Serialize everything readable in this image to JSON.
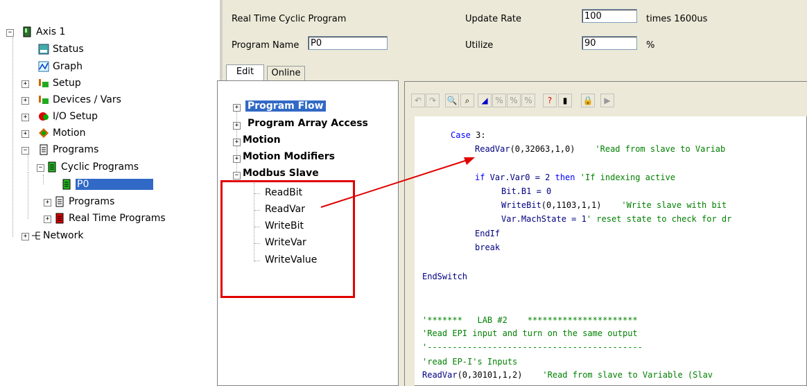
{
  "left_tree": {
    "root": "Axis 1",
    "status": "Status",
    "graph": "Graph",
    "setup": "Setup",
    "devices": "Devices / Vars",
    "io_setup": "I/O Setup",
    "motion": "Motion",
    "programs": "Programs",
    "cyclic_programs": "Cyclic Programs",
    "p0": "P0",
    "sub_programs": "Programs",
    "real_time_programs": "Real Time Programs",
    "network": "Network"
  },
  "header": {
    "title": "Real Time Cyclic Program",
    "update_rate_label": "Update Rate",
    "update_rate_value": "100",
    "update_rate_unit": "times  1600us",
    "program_name_label": "Program Name",
    "program_name_value": "P0",
    "utilize_label": "Utilize",
    "utilize_value": "90",
    "utilize_unit": "%"
  },
  "tabs": [
    "Edit",
    "Online"
  ],
  "func_tree": {
    "program_flow": "Program Flow",
    "program_array_access": "Program Array Access",
    "motion": "Motion",
    "motion_modifiers": "Motion Modifiers",
    "modbus_slave": "Modbus Slave",
    "modbus_items": [
      "ReadBit",
      "ReadVar",
      "WriteBit",
      "WriteVar",
      "WriteValue"
    ]
  },
  "code": {
    "l1_kw": "Case",
    "l1_rest": " 3:",
    "l2_fn": "ReadVar",
    "l2_args": "(0,32063,1,0)",
    "l2_cm": "    'Read from slave to Variab",
    "l3_if": "if",
    "l3_var": " Var.Var0 = 2 ",
    "l3_then": "then",
    "l3_cm": " 'If indexing active",
    "l4": "Bit.B1 = 0",
    "l5_fn": "WriteBit",
    "l5_args": "(0,1103,1,1)",
    "l5_cm": "    'Write slave with bit",
    "l6_var": "Var.MachState = 1",
    "l6_cm": "' reset state to check for dr",
    "l7": "EndIf",
    "l8": "break",
    "l9": "EndSwitch",
    "l10": "'*******   LAB #2    **********************",
    "l11": "'Read EPI input and turn on the same output",
    "l12": "'-------------------------------------------",
    "l13": "'read EP-I's Inputs",
    "l14_fn": "ReadVar",
    "l14_args": "(0,30101,1,2)",
    "l14_cm": "    'Read from slave to Variable (Slav"
  }
}
